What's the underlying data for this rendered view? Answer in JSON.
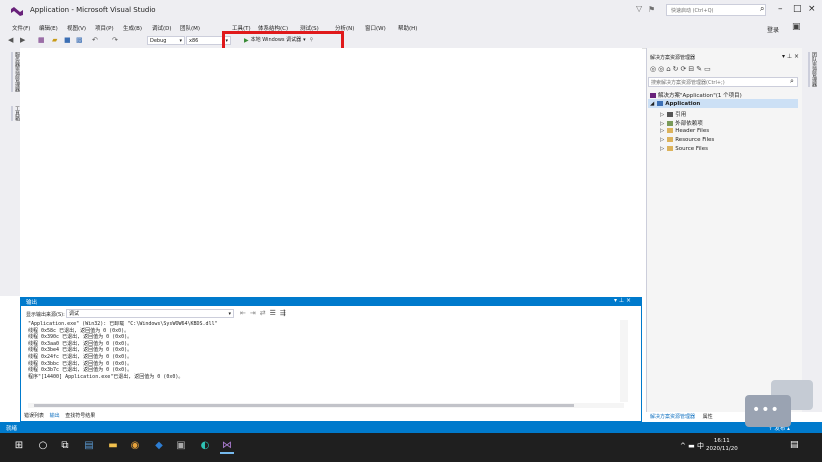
{
  "window": {
    "title": "Application - Microsoft Visual Studio",
    "quick_launch_placeholder": "快速启动 (Ctrl+Q)",
    "sign_in": "登录",
    "controls": [
      "–",
      "□",
      "×"
    ]
  },
  "menus": [
    {
      "label": "文件(F)"
    },
    {
      "label": "编辑(E)"
    },
    {
      "label": "视图(V)"
    },
    {
      "label": "项目(P)"
    },
    {
      "label": "生成(B)"
    },
    {
      "label": "调试(D)"
    },
    {
      "label": "团队(M)"
    },
    {
      "label": "工具(T)"
    },
    {
      "label": "体系结构(C)"
    },
    {
      "label": "测试(S)"
    },
    {
      "label": "分析(N)"
    },
    {
      "label": "窗口(W)"
    },
    {
      "label": "帮助(H)"
    }
  ],
  "toolbar": {
    "configuration": "Debug",
    "platform": "x86",
    "run_label": "本地 Windows 调试器"
  },
  "left_tabs": [
    "服务器资源管理器",
    "工具箱"
  ],
  "right_tabs": [
    "团队资源管理器"
  ],
  "solution_explorer": {
    "title": "解决方案资源管理器",
    "search_placeholder": "搜索解决方案资源管理器(Ctrl+;)",
    "tree": [
      {
        "label": "解决方案\"Application\"(1 个项目)",
        "level": 0,
        "icon": "solution-icon"
      },
      {
        "label": "Application",
        "level": 1,
        "icon": "project-icon",
        "selected": true
      },
      {
        "label": "引用",
        "level": 2,
        "icon": "references-icon"
      },
      {
        "label": "外部依赖项",
        "level": 2,
        "icon": "external-deps-icon"
      },
      {
        "label": "Header Files",
        "level": 2,
        "icon": "folder-icon"
      },
      {
        "label": "Resource Files",
        "level": 2,
        "icon": "folder-icon"
      },
      {
        "label": "Source Files",
        "level": 2,
        "icon": "folder-icon"
      }
    ],
    "bottom_tabs": [
      "解决方案资源管理器",
      "属性"
    ]
  },
  "output": {
    "title": "输出",
    "source_label": "显示输出来源(S):",
    "source_value": "调试",
    "lines": [
      "\"Application.exe\" (Win32): 已卸载 \"C:\\Windows\\SysWOW64\\KBDS.dll\"",
      "线程 0x58c 已退出, 返回值为 0 (0x0)。",
      "线程 0x390c 已退出, 返回值为 0 (0x0)。",
      "线程 0x3aa0 已退出, 返回值为 0 (0x0)。",
      "线程 0x3be4 已退出, 返回值为 0 (0x0)。",
      "线程 0x24fc 已退出, 返回值为 0 (0x0)。",
      "线程 0x3bbc 已退出, 返回值为 0 (0x0)。",
      "线程 0x3b7c 已退出, 返回值为 0 (0x0)。",
      "程序\"[14400] Application.exe\"已退出, 返回值为 0 (0x0)。"
    ],
    "bottom_tabs": [
      "错误列表",
      "输出",
      "查找符号结果"
    ]
  },
  "statusbar": {
    "text": "就绪",
    "publish": "↑ 发布 ▴"
  },
  "taskbar": {
    "time": "16:11",
    "date": "2020/11/20",
    "ime": "中"
  },
  "colors": {
    "accent": "#007acc",
    "highlight_box": "#e0191b",
    "vs_purple": "#68217a"
  }
}
